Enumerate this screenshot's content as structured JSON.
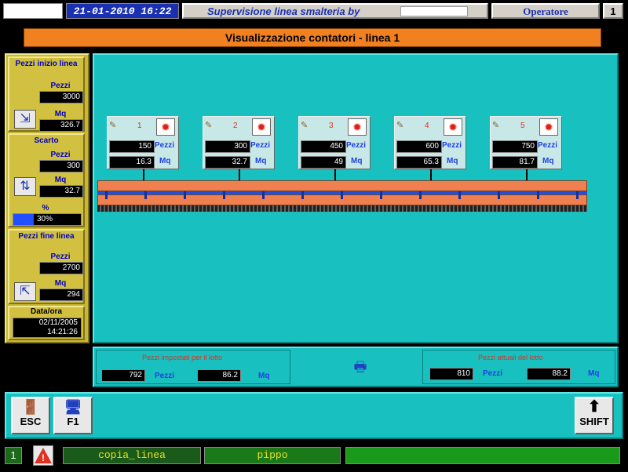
{
  "header": {
    "datetime": "21-01-2010 16:22",
    "title": "Supervisione linea smalteria by",
    "user": "Operatore",
    "page": "1"
  },
  "banner": {
    "title": "Visualizzazione contatori - linea 1"
  },
  "left": {
    "inizio": {
      "title": "Pezzi inizio linea",
      "pezzi_label": "Pezzi",
      "pezzi": "3000",
      "mq_label": "Mq",
      "mq": "326.7"
    },
    "scarto": {
      "title": "Scarto",
      "pezzi_label": "Pezzi",
      "pezzi": "300",
      "mq_label": "Mq",
      "mq": "32.7",
      "pct_label": "%",
      "pct": "30%",
      "pct_fill": 0.3
    },
    "fine": {
      "title": "Pezzi fine linea",
      "pezzi_label": "Pezzi",
      "pezzi": "2700",
      "mq_label": "Mq",
      "mq": "294"
    },
    "dataora": {
      "title": "Data/ora",
      "date": "02/11/2005",
      "time": "14:21:26"
    }
  },
  "stations": [
    {
      "num": "1",
      "pezzi": "150",
      "mq": "16.3",
      "pezzi_label": "Pezzi",
      "mq_label": "Mq"
    },
    {
      "num": "2",
      "pezzi": "300",
      "mq": "32.7",
      "pezzi_label": "Pezzi",
      "mq_label": "Mq"
    },
    {
      "num": "3",
      "pezzi": "450",
      "mq": "49",
      "pezzi_label": "Pezzi",
      "mq_label": "Mq"
    },
    {
      "num": "4",
      "pezzi": "600",
      "mq": "65.3",
      "pezzi_label": "Pezzi",
      "mq_label": "Mq"
    },
    {
      "num": "5",
      "pezzi": "750",
      "mq": "81.7",
      "pezzi_label": "Pezzi",
      "mq_label": "Mq"
    }
  ],
  "lot": {
    "set_title": "Pezzi impostati per il lotto",
    "set_pezzi": "792",
    "set_mq": "86.2",
    "act_title": "Pezzi attuali del lotto",
    "act_pezzi": "810",
    "act_mq": "88.2",
    "pezzi_label": "Pezzi",
    "mq_label": "Mq"
  },
  "buttons": {
    "esc": "ESC",
    "f1": "F1",
    "shift": "SHIFT"
  },
  "status": {
    "num": "1",
    "field1": "copia_linea",
    "field2": "pippo"
  },
  "colors": {
    "cyan": "#18c0c0",
    "orange": "#f08020",
    "yellow": "#d2c040",
    "green": "#1a8a1a"
  }
}
